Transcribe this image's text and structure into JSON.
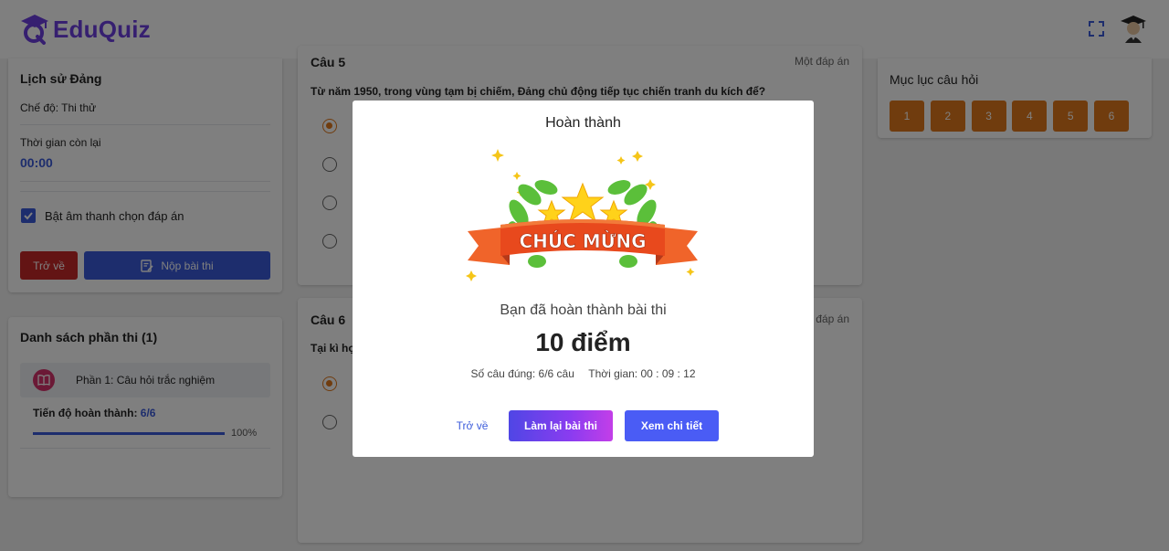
{
  "header": {
    "logo_text": "EduQuiz",
    "icons": {
      "fullscreen": "fullscreen-icon",
      "avatar": "graduate-avatar"
    }
  },
  "exam": {
    "subject": "Lịch sử Đảng",
    "mode": "Chế độ: Thi thử",
    "time_label": "Thời gian còn lại",
    "time_value": "00:00",
    "sound_label": "Bật âm thanh chọn đáp án",
    "sound_enabled": true,
    "back_label": "Trở về",
    "submit_label": "Nộp bài thi"
  },
  "sections": {
    "title": "Danh sách phần thi (1)",
    "items": [
      {
        "label": "Phần 1: Câu hỏi trắc nghiệm",
        "icon": "book-icon"
      }
    ],
    "progress_label": "Tiến độ hoàn thành:",
    "progress_value": "6/6",
    "progress_percent": "100%",
    "progress_fraction": 1.0
  },
  "questions": [
    {
      "number": "Câu 5",
      "type": "Một đáp án",
      "text": "Từ năm 1950, trong vùng tạm bị chiếm, Đảng chủ động tiếp tục chiến tranh du kích để?",
      "selected_option": 0,
      "option_count": 4
    },
    {
      "number": "Câu 6",
      "type": "Một đáp án",
      "text": "Tại kì họ",
      "selected_option": 0,
      "option_count": 2
    }
  ],
  "index": {
    "title": "Mục lục câu hỏi",
    "buttons": [
      "1",
      "2",
      "3",
      "4",
      "5",
      "6"
    ]
  },
  "modal": {
    "title": "Hoàn thành",
    "banner_text": "CHÚC MỪNG",
    "message": "Bạn đã hoàn thành bài thi",
    "score": "10 điểm",
    "correct_label": "Số câu đúng: 6/6 câu",
    "time_label": "Thời gian: 00 : 09 : 12",
    "back_label": "Trở về",
    "retry_label": "Làm lại bài thi",
    "detail_label": "Xem chi tiết"
  },
  "colors": {
    "primary": "#3b5bdb",
    "accent_orange": "#e0781c",
    "danger": "#c62828",
    "brand_purple": "#6d3fe0"
  }
}
